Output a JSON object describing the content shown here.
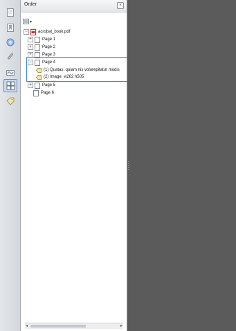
{
  "panel": {
    "title": "Order",
    "close_glyph": "×"
  },
  "toolbar": {
    "options_arrow": "▾"
  },
  "tree": {
    "root": {
      "label": "acrobat_book.pdf",
      "expander": "−"
    },
    "pages": [
      {
        "label": "Page 1",
        "expander": "+"
      },
      {
        "label": "Page 2",
        "expander": "+"
      },
      {
        "label": "Page 3",
        "expander": "+"
      },
      {
        "label": "Page 4",
        "expander": "−"
      },
      {
        "label": "Page 5",
        "expander": "+"
      },
      {
        "label": "Page 6",
        "expander": ""
      }
    ],
    "page4_children": [
      {
        "label": "(1) Quatas, quiam nis volorepitatur modis",
        "icon": "tag-icon"
      },
      {
        "label": "(2) Image: w262 h505",
        "icon": "tag-icon"
      }
    ]
  },
  "tools": [
    {
      "name": "page-thumbnails-icon"
    },
    {
      "name": "bookmarks-icon"
    },
    {
      "name": "layers-icon"
    },
    {
      "name": "attachments-icon"
    },
    {
      "name": "signatures-icon"
    },
    {
      "name": "order-panel-icon"
    },
    {
      "name": "tags-icon"
    }
  ],
  "colors": {
    "selection_border": "#3d86d6",
    "document_background": "#5b5b5b",
    "pdf_icon": "#cc2a2a"
  }
}
